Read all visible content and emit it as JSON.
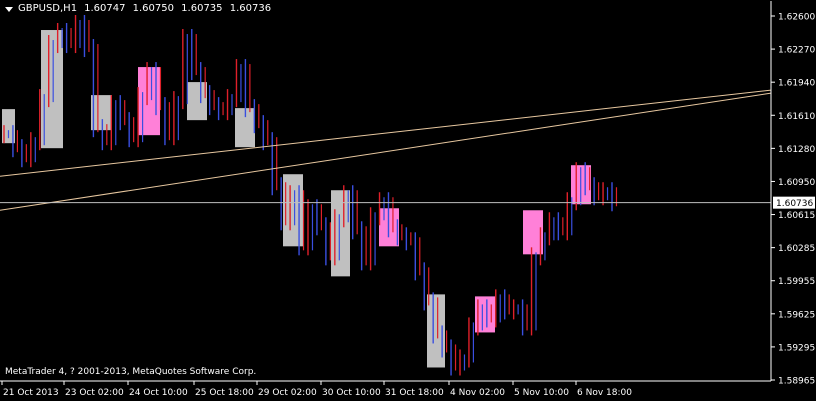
{
  "header": {
    "symbol": "GBPUSD,H1",
    "open": "1.60747",
    "high": "1.60750",
    "low": "1.60735",
    "close": "1.60736"
  },
  "copyright": "MetaTrader 4, ? 2001-2013, MetaQuotes Software Corp.",
  "colors": {
    "background": "#000000",
    "axis": "#ffffff",
    "bull_candle": "#e0202a",
    "bear_candle": "#3a4fe0",
    "box_gray": "#c0c0c0",
    "box_pink": "#ff80d8",
    "trendline": "#e8c8a0",
    "price_line": "#c0c0c0"
  },
  "chart_data": {
    "type": "line",
    "symbol": "GBPUSD",
    "timeframe": "H1",
    "ylim": [
      1.5885,
      1.6275
    ],
    "y_ticks": [
      "1.62600",
      "1.62270",
      "1.61940",
      "1.61610",
      "1.61280",
      "1.60950",
      "1.60615",
      "1.60285",
      "1.59955",
      "1.59625",
      "1.59295",
      "1.58965"
    ],
    "x_ticks": [
      "21 Oct 2013",
      "23 Oct 02:00",
      "24 Oct 10:00",
      "25 Oct 18:00",
      "29 Oct 02:00",
      "30 Oct 10:00",
      "31 Oct 18:00",
      "4 Nov 02:00",
      "5 Nov 10:00",
      "6 Nov 18:00"
    ],
    "current_price": "1.60736",
    "series": [
      {
        "values": [
          1.6142,
          1.6128,
          1.6118,
          1.6135,
          1.6178,
          1.6232,
          1.6244,
          1.6232,
          1.6252,
          1.6228,
          1.6148,
          1.6135,
          1.6172,
          1.6155,
          1.6138,
          1.618,
          1.6205,
          1.617,
          1.614,
          1.6176,
          1.6238,
          1.6205,
          1.6182,
          1.617,
          1.6165,
          1.6178,
          1.6208,
          1.6168,
          1.6152,
          1.6135,
          1.609,
          1.6055,
          1.6082,
          1.603,
          1.6068,
          1.605,
          1.602,
          1.6058,
          1.6082,
          1.6046,
          1.6015,
          1.606,
          1.6075,
          1.6048,
          1.604,
          1.6035,
          1.6005,
          1.5975,
          1.5942,
          1.5928,
          1.591,
          1.5918,
          1.595,
          1.5968,
          1.5958,
          1.5978,
          1.5966,
          1.5968,
          1.595,
          1.602,
          1.604,
          1.6055,
          1.6045,
          1.6075,
          1.6105,
          1.609,
          1.608,
          1.6085,
          1.6074
        ]
      }
    ],
    "boxes": [
      {
        "color": "gray",
        "high": 1.6167,
        "low": 1.6133
      },
      {
        "color": "gray",
        "high": 1.6246,
        "low": 1.6128
      },
      {
        "color": "gray",
        "high": 1.6181,
        "low": 1.6146
      },
      {
        "color": "pink",
        "high": 1.6209,
        "low": 1.6141
      },
      {
        "color": "gray",
        "high": 1.6194,
        "low": 1.6156
      },
      {
        "color": "gray",
        "high": 1.6168,
        "low": 1.6129
      },
      {
        "color": "gray",
        "high": 1.6102,
        "low": 1.603
      },
      {
        "color": "gray",
        "high": 1.6086,
        "low": 1.6
      },
      {
        "color": "pink",
        "high": 1.6068,
        "low": 1.603
      },
      {
        "color": "gray",
        "high": 1.5982,
        "low": 1.5909
      },
      {
        "color": "pink",
        "high": 1.598,
        "low": 1.5944
      },
      {
        "color": "pink",
        "high": 1.6066,
        "low": 1.6022
      },
      {
        "color": "pink",
        "high": 1.6111,
        "low": 1.6072
      }
    ],
    "trendlines": [
      {
        "y_start": 1.61,
        "y_end": 1.6186
      },
      {
        "y_start": 1.6066,
        "y_end": 1.6183
      }
    ]
  }
}
